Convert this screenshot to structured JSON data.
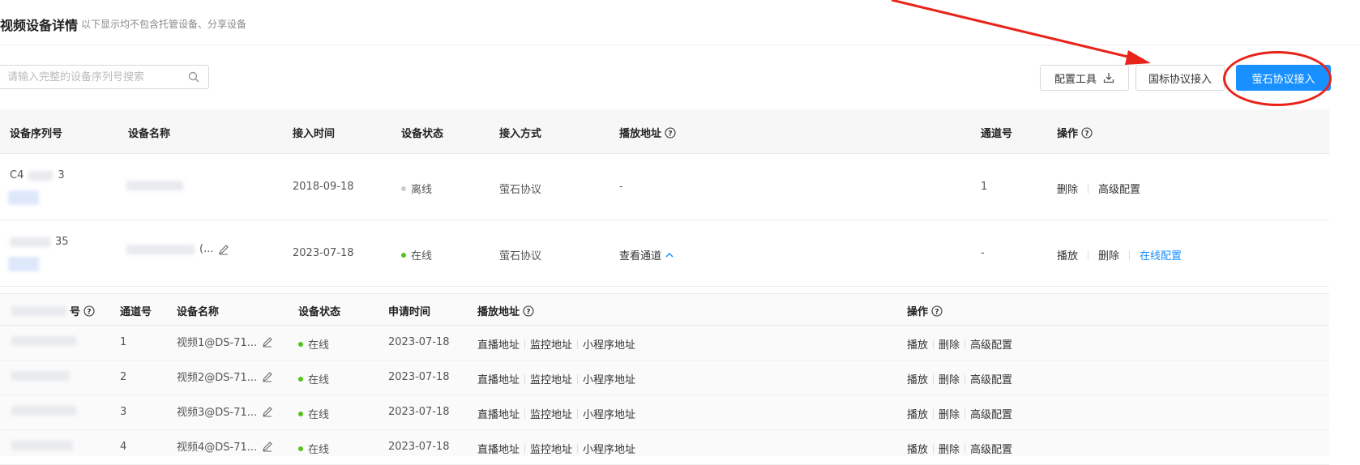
{
  "header": {
    "title": "视频设备详情",
    "subtitle": "以下显示均不包含托管设备、分享设备"
  },
  "search": {
    "placeholder": "请输入完整的设备序列号搜索"
  },
  "toolbar": {
    "config_tool": "配置工具",
    "gb_access": "国标协议接入",
    "ezviz_access": "萤石协议接入"
  },
  "table": {
    "headers": {
      "serial": "设备序列号",
      "name": "设备名称",
      "access_time": "接入时间",
      "status": "设备状态",
      "access_method": "接入方式",
      "play_url": "播放地址",
      "channel": "通道号",
      "ops": "操作"
    },
    "rows": [
      {
        "serial": "C4",
        "serial_tail": "3",
        "access_time": "2018-09-18",
        "status": "离线",
        "status_color": "#cccccc",
        "access_method": "萤石协议",
        "play_url": "-",
        "channel": "1",
        "ops": [
          "删除",
          "高级配置"
        ]
      },
      {
        "serial_tail": "35",
        "name_suffix": "(...",
        "access_time": "2023-07-18",
        "status": "在线",
        "status_color": "#52c41a",
        "access_method": "萤石协议",
        "play_url": "查看通道",
        "channel": "-",
        "ops": [
          "播放",
          "删除",
          "在线配置"
        ]
      }
    ]
  },
  "subtable": {
    "headers": {
      "serial_suffix": "号",
      "channel": "通道号",
      "name": "设备名称",
      "status": "设备状态",
      "apply_time": "申请时间",
      "play_url": "播放地址",
      "ops": "操作"
    },
    "rows": [
      {
        "channel": "1",
        "name": "视频1@DS-71...",
        "status": "在线",
        "apply_time": "2023-07-18"
      },
      {
        "channel": "2",
        "name": "视频2@DS-71...",
        "status": "在线",
        "apply_time": "2023-07-18"
      },
      {
        "channel": "3",
        "name": "视频3@DS-71...",
        "status": "在线",
        "apply_time": "2023-07-18"
      },
      {
        "channel": "4",
        "name": "视频4@DS-71...",
        "status": "在线",
        "apply_time": "2023-07-18"
      }
    ],
    "play_links": [
      "直播地址",
      "监控地址",
      "小程序地址"
    ],
    "ops": [
      "播放",
      "删除",
      "高级配置"
    ]
  },
  "colors": {
    "primary": "#1890ff",
    "annotation": "#e8231a",
    "online": "#52c41a",
    "offline": "#cccccc"
  }
}
